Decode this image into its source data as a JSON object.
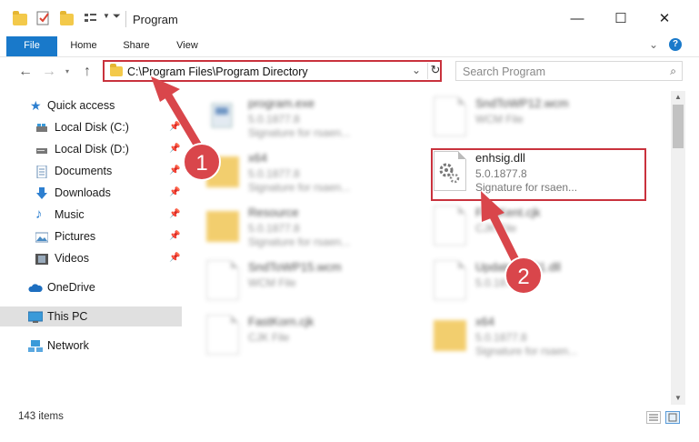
{
  "window": {
    "title": "Program",
    "minimize_icon": "minimize-icon",
    "maximize_icon": "maximize-icon",
    "close_icon": "close-icon"
  },
  "ribbon": {
    "tabs": [
      "File",
      "Home",
      "Share",
      "View"
    ],
    "help_label": "?",
    "accent": "#1979ca"
  },
  "address": {
    "path": "C:\\Program Files\\Program Directory",
    "search_placeholder": "Search Program"
  },
  "sidebar": {
    "quick_access": "Quick access",
    "items": [
      {
        "label": "Local Disk (C:)",
        "icon": "drive-icon",
        "pinned": true
      },
      {
        "label": "Local Disk (D:)",
        "icon": "drive-icon",
        "pinned": true
      },
      {
        "label": "Documents",
        "icon": "documents-icon",
        "pinned": true
      },
      {
        "label": "Downloads",
        "icon": "download-icon",
        "pinned": true
      },
      {
        "label": "Music",
        "icon": "music-icon",
        "pinned": true
      },
      {
        "label": "Pictures",
        "icon": "pictures-icon",
        "pinned": true
      },
      {
        "label": "Videos",
        "icon": "videos-icon",
        "pinned": true
      }
    ],
    "onedrive": "OneDrive",
    "this_pc": "This PC",
    "network": "Network"
  },
  "files": {
    "left_column": [
      {
        "name": "program.exe",
        "line1": "5.0.1877.8",
        "line2": "Signature for rsaen...",
        "icon": "exe-icon"
      },
      {
        "name": "x64",
        "line1": "5.0.1877.8",
        "line2": "Signature for rsaen...",
        "icon": "folder-icon"
      },
      {
        "name": "Resource",
        "line1": "5.0.1877.8",
        "line2": "Signature for rsaen...",
        "icon": "folder-icon"
      },
      {
        "name": "SndToWP15.wcm",
        "line1": "WCM File",
        "line2": "",
        "icon": "file-icon"
      },
      {
        "name": "FastKorn.cjk",
        "line1": "CJK File",
        "line2": "",
        "icon": "file-icon"
      }
    ],
    "right_column": [
      {
        "name": "SndToWP12.wcm",
        "line1": "WCM File",
        "line2": "",
        "icon": "file-icon"
      },
      {
        "name": "enhsig.dll",
        "line1": "5.0.1877.8",
        "line2": "Signature for rsaen...",
        "icon": "dll-gear-icon",
        "highlighted": true
      },
      {
        "name": "FastKent.cjk",
        "line1": "CJK File",
        "line2": "",
        "icon": "file-icon"
      },
      {
        "name": "UpdateWP21.dll",
        "line1": "5.0.1877.8",
        "line2": "",
        "icon": "dll-gear-icon"
      },
      {
        "name": "x64",
        "line1": "5.0.1877.8",
        "line2": "Signature for rsaen...",
        "icon": "folder-icon"
      }
    ]
  },
  "status": {
    "item_count": "143 items"
  },
  "annotations": {
    "step1": "1",
    "step2": "2",
    "arrow_color": "#d9464b"
  }
}
